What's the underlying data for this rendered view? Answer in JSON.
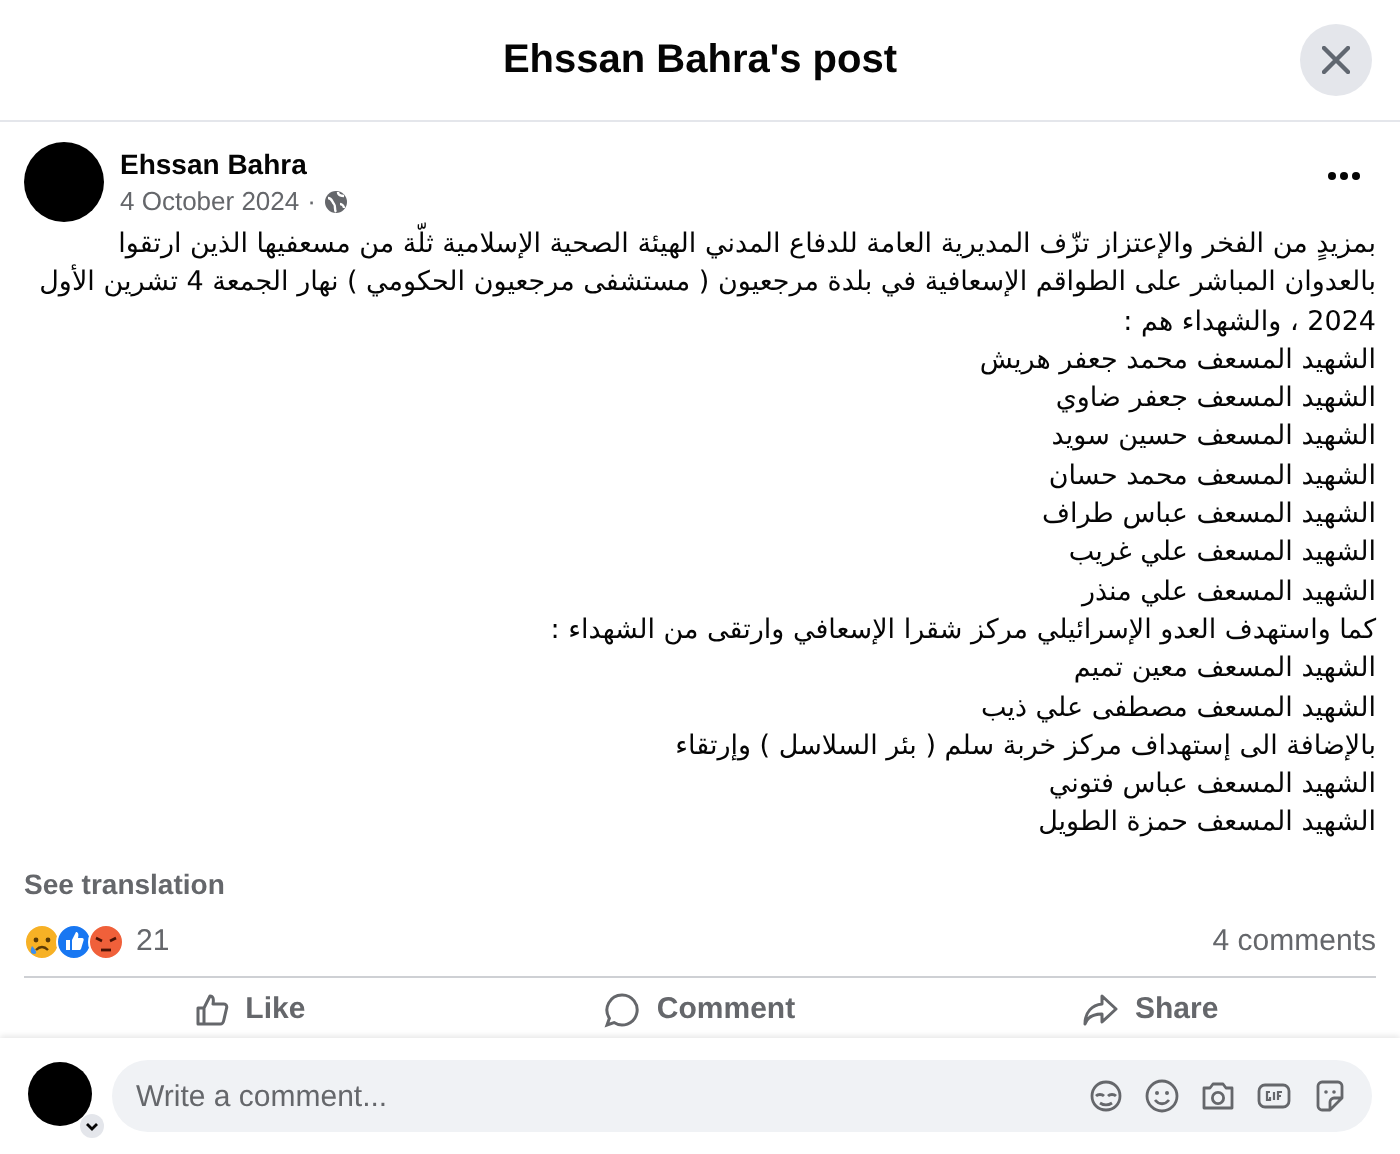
{
  "dialog": {
    "title": "Ehssan Bahra's post"
  },
  "post": {
    "author": "Ehssan Bahra",
    "date": "4 October 2024",
    "separator": "·",
    "paragraphs": [
      "بمزيدٍ من الفخر والإعتزاز تزّف المديرية العامة للدفاع المدني  الهيئة الصحية الإسلامية ثلّة من مسعفيها الذين ارتقوا بالعدوان المباشر على الطواقم الإسعافية في بلدة مرجعيون ( مستشفى مرجعيون الحكومي ) نهار الجمعة 4 تشرين الأول 2024 ، والشهداء هم :",
      "الشهيد المسعف محمد جعفر هريش",
      "الشهيد المسعف جعفر ضاوي",
      "الشهيد المسعف حسين سويد",
      "الشهيد المسعف محمد حسان",
      "الشهيد المسعف عباس طراف",
      "الشهيد المسعف علي غريب",
      "الشهيد المسعف علي منذر",
      "كما واستهدف العدو الإسرائيلي مركز شقرا  الإسعافي وارتقى من الشهداء :",
      "الشهيد المسعف معين تميم",
      "الشهيد المسعف مصطفى علي ذيب",
      "بالإضافة الى إستهداف مركز خربة سلم ( بئر السلاسل ) وإرتقاء",
      "الشهيد المسعف عباس فتوني",
      "الشهيد المسعف حمزة الطويل"
    ],
    "see_translation": "See translation",
    "reactions": [
      {
        "kind": "sad"
      },
      {
        "kind": "like"
      },
      {
        "kind": "angry"
      }
    ],
    "reaction_count": "21",
    "comments_count": "4 comments"
  },
  "action_bar": {
    "like": "Like",
    "comment": "Comment",
    "share": "Share"
  },
  "composer": {
    "placeholder": "Write a comment..."
  }
}
